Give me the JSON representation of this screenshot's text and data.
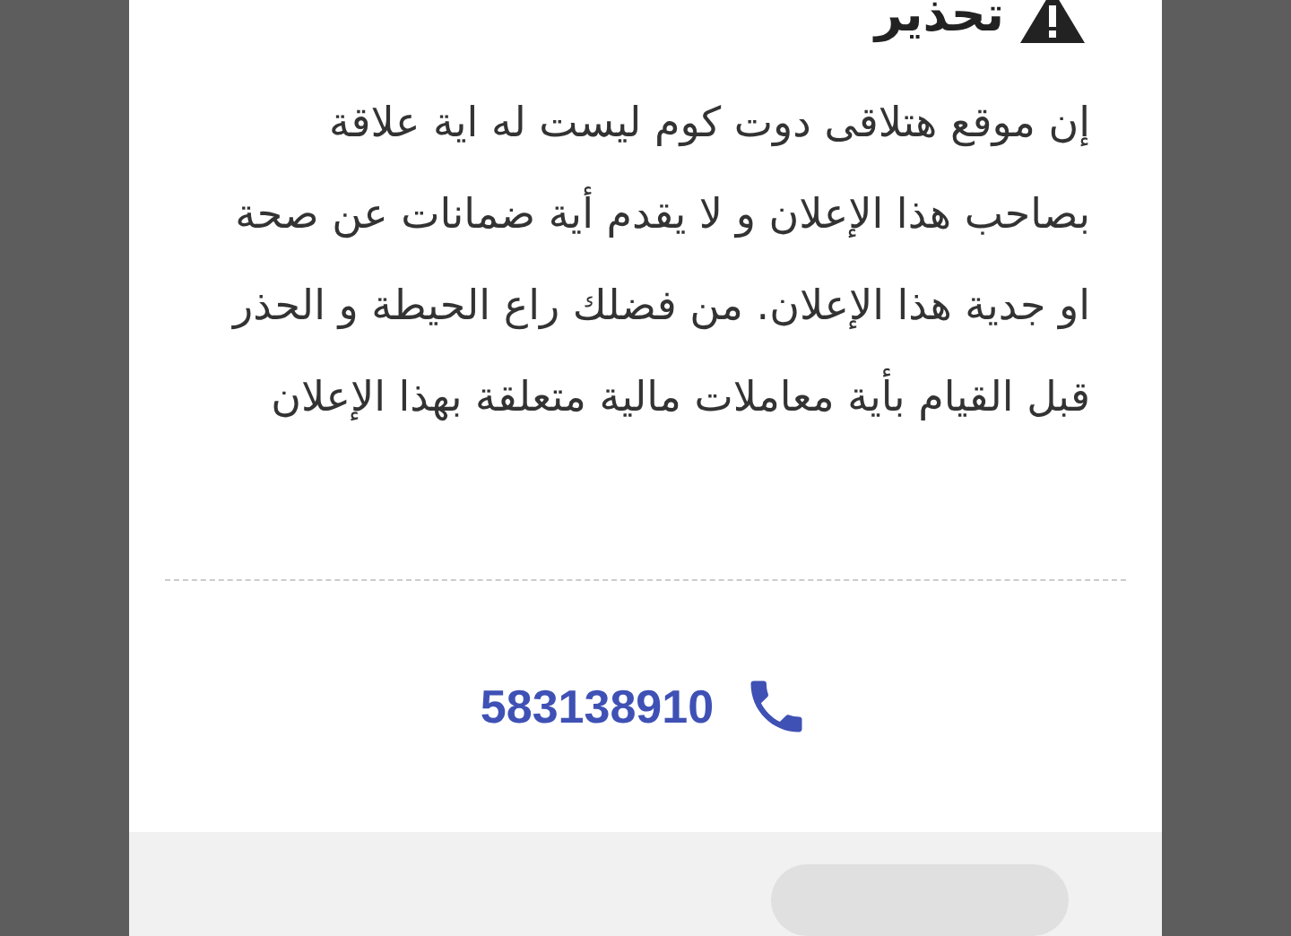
{
  "dialog": {
    "title": "تحذير",
    "message": "إن موقع هتلاقى دوت كوم ليست له اية علاقة بصاحب هذا الإعلان و لا يقدم أية ضمانات عن صحة او جدية هذا الإعلان. من فضلك راع الحيطة و الحذر قبل القيام بأية معاملات مالية متعلقة بهذا الإعلان",
    "phone": "583138910"
  }
}
